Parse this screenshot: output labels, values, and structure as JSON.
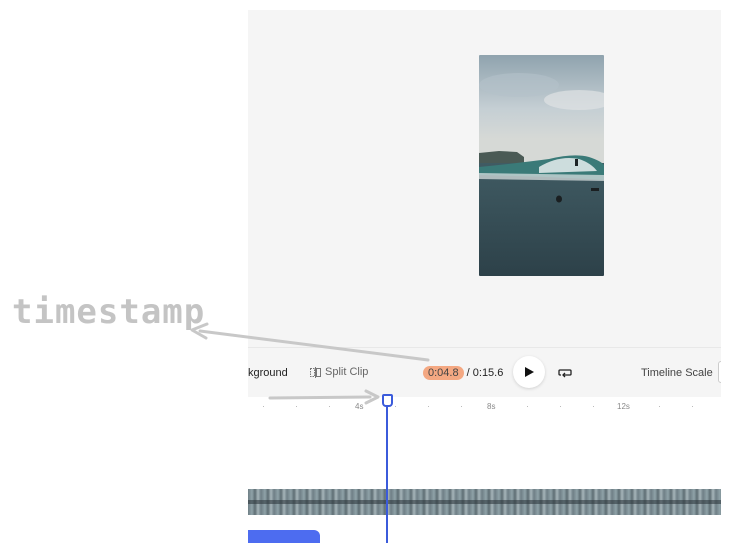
{
  "annotation": {
    "label": "timestamp"
  },
  "toolbar": {
    "background_label": "kground",
    "split_clip_label": "Split Clip",
    "current_time": "0:04.8",
    "separator": " / ",
    "total_time": "0:15.6",
    "timeline_scale_label": "Timeline Scale"
  },
  "ruler": {
    "labels": [
      "4s",
      "8s",
      "12s"
    ]
  },
  "colors": {
    "accent": "#3b5bdb",
    "timestamp_highlight": "#f4a882",
    "track_bar": "#4d6cf0"
  },
  "icons": [
    "split-icon",
    "play-icon",
    "loop-icon"
  ]
}
